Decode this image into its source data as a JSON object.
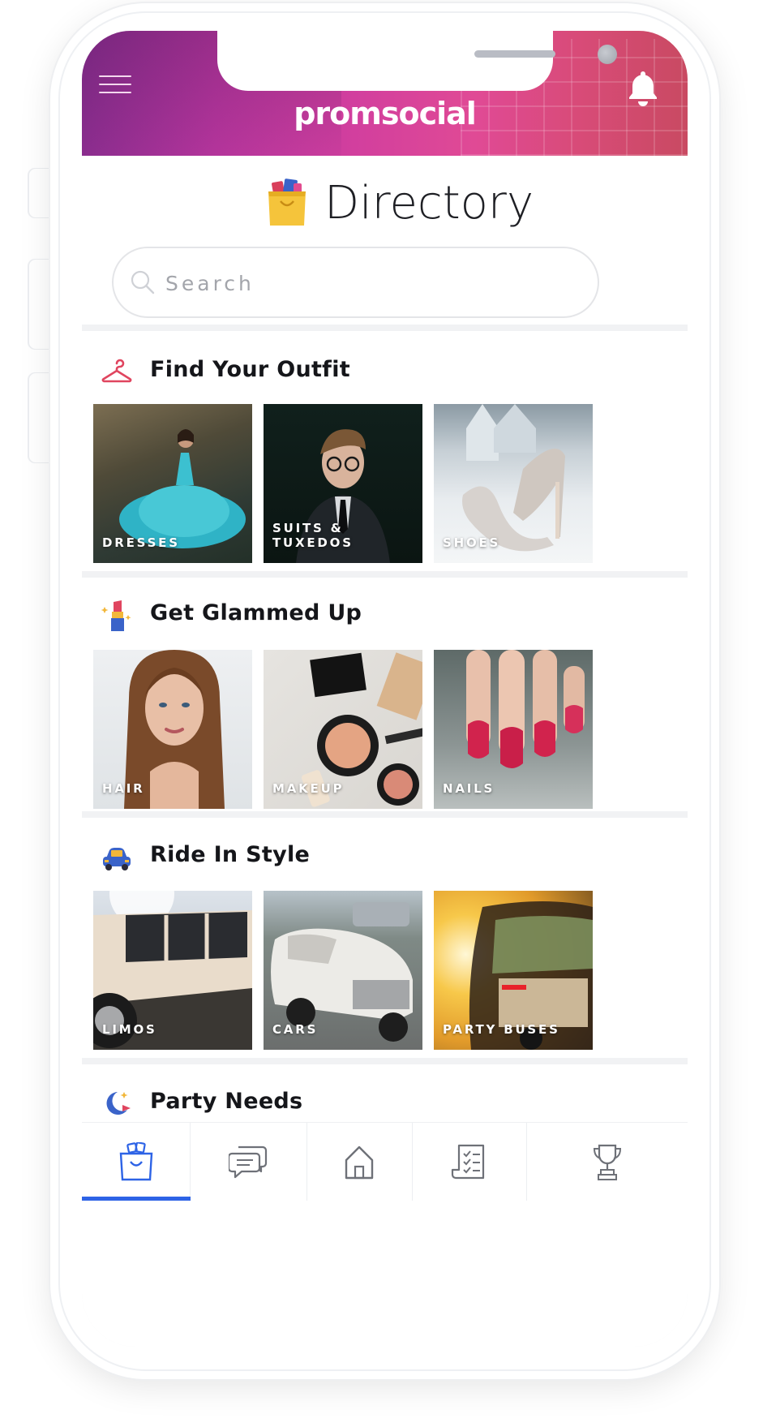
{
  "header": {
    "logo": "promsocial"
  },
  "page": {
    "title": "Directory"
  },
  "search": {
    "placeholder": "Search"
  },
  "sections": [
    {
      "title": "Find Your Outfit",
      "icon": "hanger-icon",
      "tiles": [
        {
          "label": "DRESSES"
        },
        {
          "label": "SUITS & TUXEDOS"
        },
        {
          "label": "SHOES"
        }
      ]
    },
    {
      "title": "Get Glammed Up",
      "icon": "lipstick-icon",
      "tiles": [
        {
          "label": "HAIR"
        },
        {
          "label": "MAKEUP"
        },
        {
          "label": "NAILS"
        }
      ]
    },
    {
      "title": "Ride In Style",
      "icon": "car-icon",
      "tiles": [
        {
          "label": "LIMOS"
        },
        {
          "label": "CARS"
        },
        {
          "label": "PARTY BUSES"
        }
      ]
    },
    {
      "title": "Party Needs",
      "icon": "moon-party-icon"
    }
  ],
  "tabbar": {
    "items": [
      {
        "icon": "shopping-bag-icon",
        "active": true
      },
      {
        "icon": "chat-bubbles-icon",
        "active": false
      },
      {
        "icon": "home-icon",
        "active": false
      },
      {
        "icon": "checklist-icon",
        "active": false
      },
      {
        "icon": "trophy-icon",
        "active": false
      }
    ],
    "active_color": "#2d63e6"
  },
  "colors": {
    "header_gradient_start": "#8b2d8e",
    "header_gradient_end": "#c94a62",
    "accent": "#2d63e6"
  }
}
